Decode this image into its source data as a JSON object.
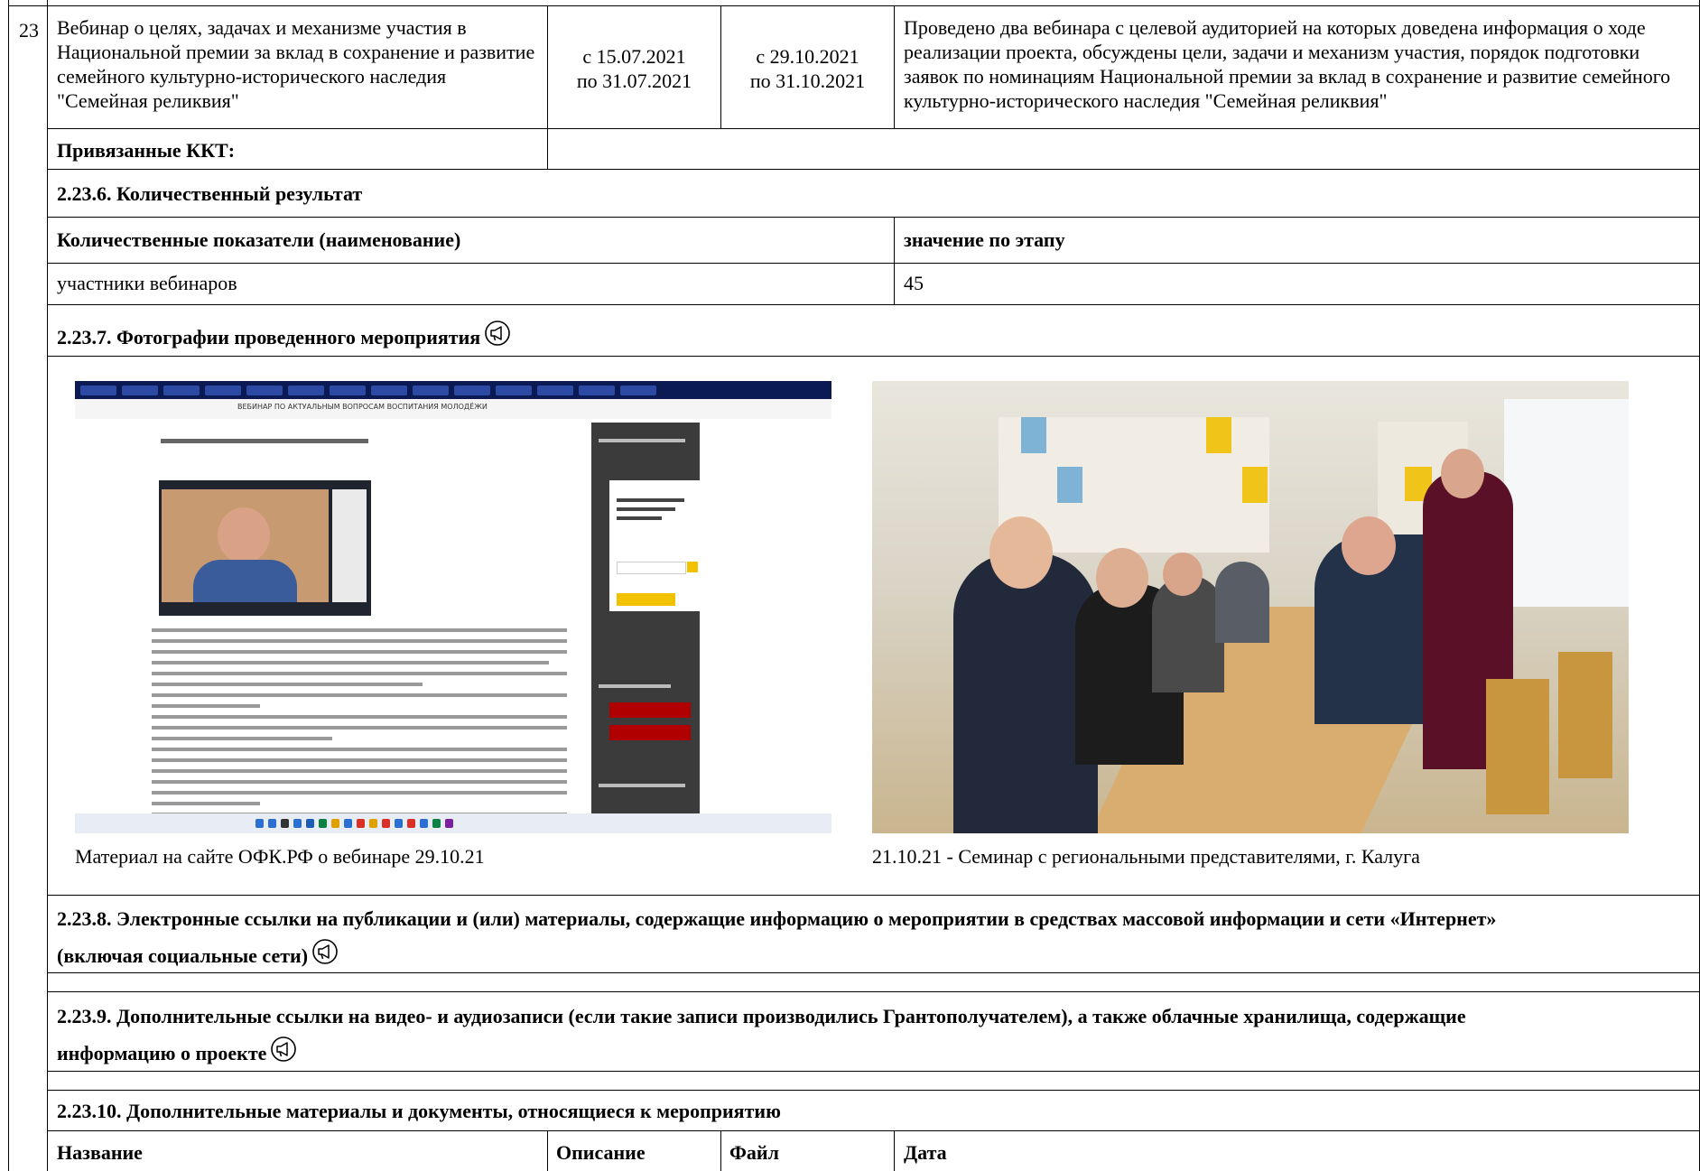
{
  "row": {
    "number": "23",
    "event_name": "Вебинар о целях, задачах и механизме участия в Национальной премии за вклад в сохранение и развитие семейного культурно-исторического наследия \"Семейная реликвия\"",
    "planned_start": "с 15.07.2021",
    "planned_end": "по 31.07.2021",
    "actual_start": "с 29.10.2021",
    "actual_end": "по 31.10.2021",
    "description": "Проведено два вебинара с целевой аудиторией на которых доведена информация о ходе реализации проекта, обсуждены цели, задачи и механизм участия, порядок подготовки заявок по номинациям Национальной премии за вклад в сохранение и развитие семейного культурно-исторического наследия \"Семейная реликвия\""
  },
  "linked_label": "Привязанные ККТ:",
  "quant": {
    "heading": "2.23.6. Количественный результат",
    "col_name": "Количественные показатели (наименование)",
    "col_value": "значение по этапу",
    "item_name": "участники вебинаров",
    "item_value": "45"
  },
  "photos": {
    "heading": "2.23.7. Фотографии проведенного мероприятия",
    "left_caption": "Материал на сайте ОФК.РФ о вебинаре 29.10.21",
    "right_caption": "21.10.21 - Семинар с региональными представителями, г. Калуга",
    "screenshot_title": "ВЕБИНАР ПО АКТУАЛЬНЫМ ВОПРОСАМ ВОСПИТАНИЯ МОЛОДЁЖИ"
  },
  "links": {
    "heading_line1": "2.23.8. Электронные ссылки на публикации и (или) материалы, содержащие информацию о мероприятии в средствах массовой информации и сети «Интернет»",
    "heading_line2": "(включая социальные сети)"
  },
  "extra_links": {
    "heading_line1": "2.23.9. Дополнительные ссылки на видео- и аудиозаписи (если такие записи производились Грантополучателем), а также облачные хранилища, содержащие",
    "heading_line2": "информацию о проекте"
  },
  "materials": {
    "heading": "2.23.10. Дополнительные материалы и документы, относящиеся к мероприятию",
    "col_name": "Название",
    "col_desc": "Описание",
    "col_file": "Файл",
    "col_date": "Дата"
  },
  "icons": {
    "section_icon": "megaphone-icon"
  }
}
